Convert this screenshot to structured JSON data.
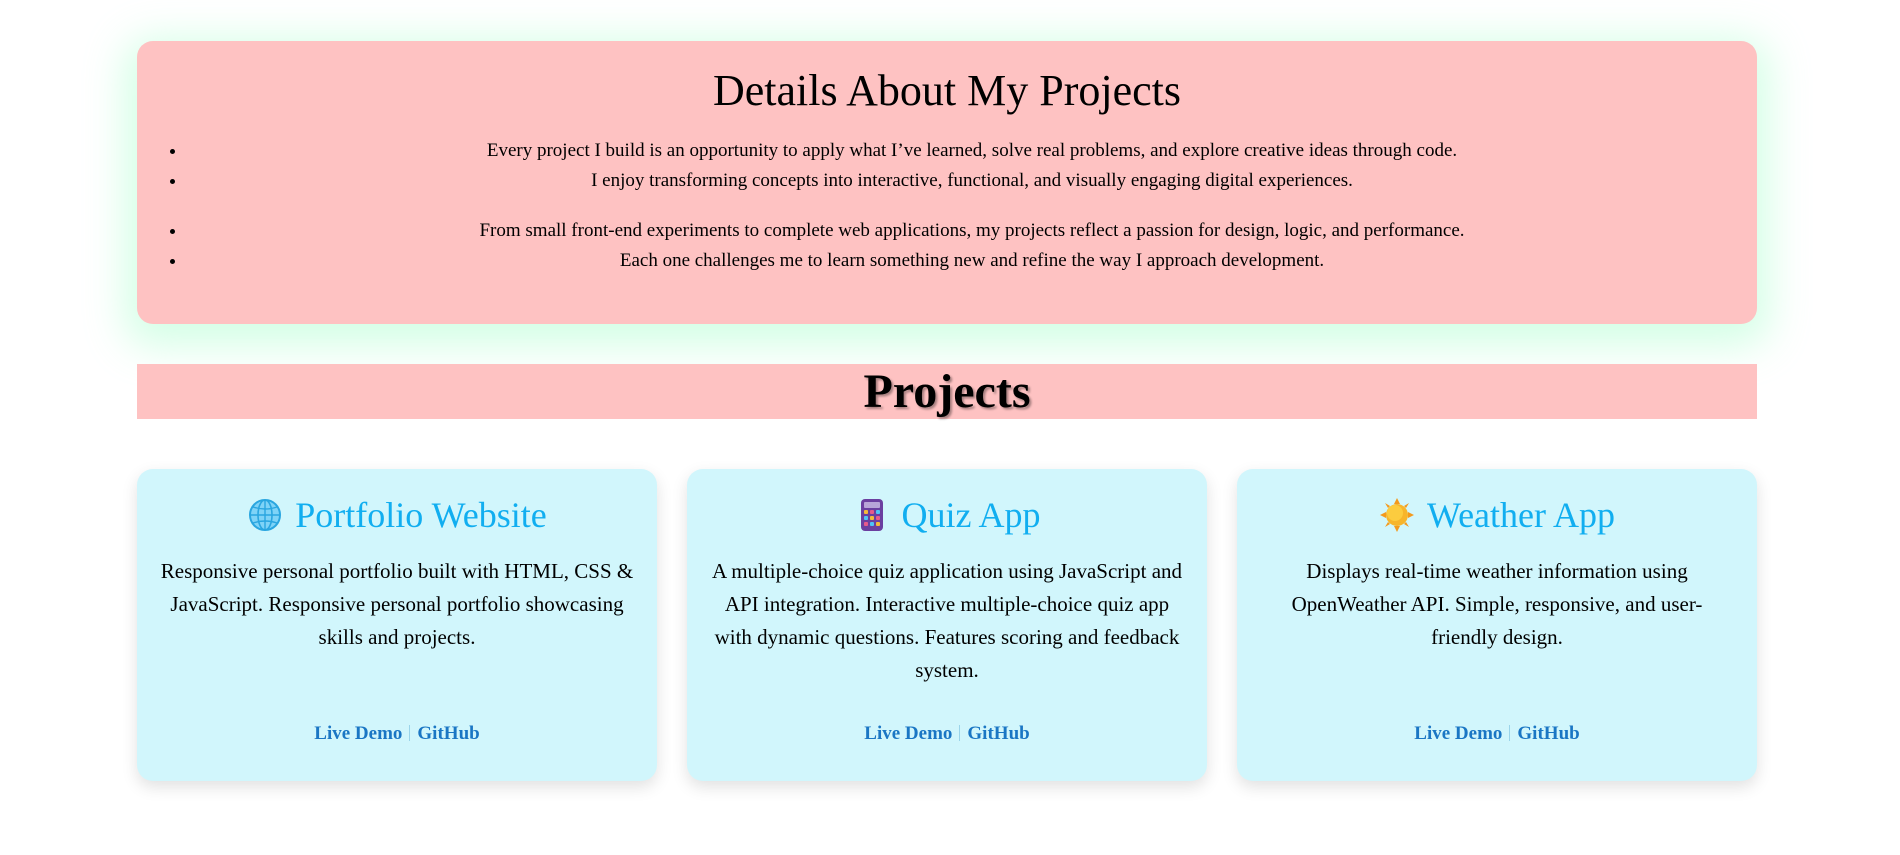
{
  "details": {
    "title": "Details About My Projects",
    "items_a": [
      "Every project I build is an opportunity to apply what I’ve learned, solve real problems, and explore creative ideas through code.",
      "I enjoy transforming concepts into interactive, functional, and visually engaging digital experiences."
    ],
    "items_b": [
      "From small front-end experiments to complete web applications, my projects reflect a passion for design, logic, and performance.",
      "Each one challenges me to learn something new and refine the way I approach development."
    ]
  },
  "projects": {
    "heading": "Projects",
    "cards": [
      {
        "icon": "globe-icon",
        "title": "Portfolio Website",
        "description": "Responsive personal portfolio built with HTML, CSS & JavaScript. Responsive personal portfolio showcasing skills and projects.",
        "live_demo": "Live Demo",
        "github": "GitHub"
      },
      {
        "icon": "calculator-icon",
        "title": "Quiz App",
        "description": "A multiple-choice quiz application using JavaScript and API integration. Interactive multiple-choice quiz app with dynamic questions. Features scoring and feedback system.",
        "live_demo": "Live Demo",
        "github": "GitHub"
      },
      {
        "icon": "sun-icon",
        "title": "Weather App",
        "description": "Displays real-time weather information using OpenWeather API. Simple, responsive, and user-friendly design.",
        "live_demo": "Live Demo",
        "github": "GitHub"
      }
    ]
  },
  "colors": {
    "panel_bg": "#fec2c2",
    "card_bg": "#d1f6fc",
    "card_title": "#11aef0",
    "link": "#1a76c4",
    "panel_glow": "#a0ffc8"
  }
}
